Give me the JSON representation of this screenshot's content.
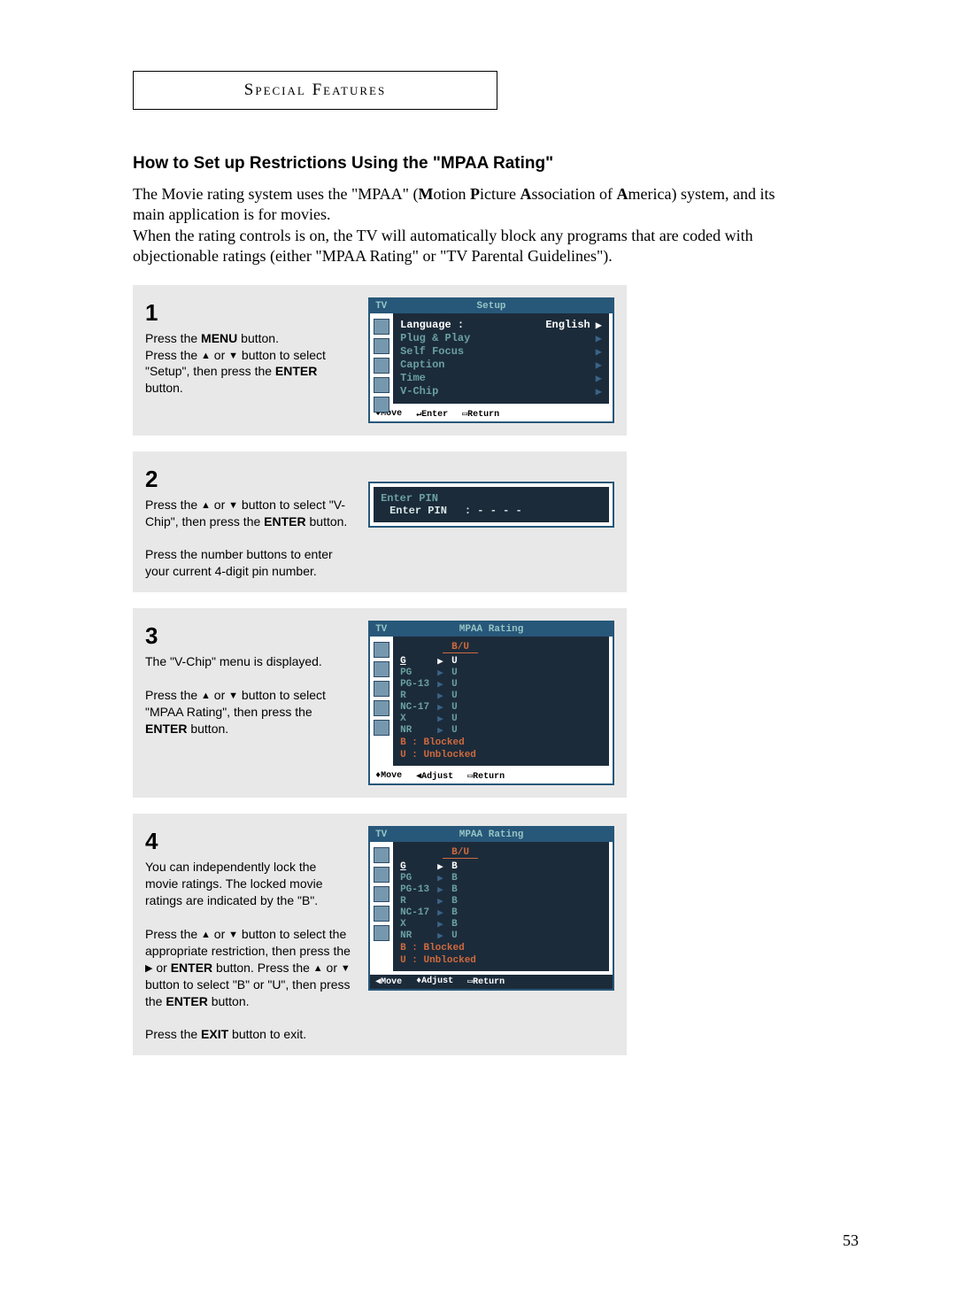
{
  "header": "Special Features",
  "title": "How to Set up Restrictions Using the \"MPAA Rating\"",
  "intro_html": "The Movie rating system uses the \"MPAA\" (<b>M</b>otion <b>P</b>icture <b>A</b>ssociation of <b>A</b>merica) system, and its main application is for movies.<br>When the rating controls is on, the TV will automatically block any programs that are coded with objectionable ratings (either \"MPAA Rating\" or \"TV Parental Guidelines\").",
  "steps": {
    "s1": {
      "num": "1",
      "text_html": "Press the <b>MENU</b> button.<br>Press the <span class='arrow-glyph'>▲</span> or <span class='arrow-glyph'>▼</span> button to select \"Setup\", then press the <b>ENTER</b> button."
    },
    "s2": {
      "num": "2",
      "text_html": "Press the <span class='arrow-glyph'>▲</span> or <span class='arrow-glyph'>▼</span> button to select \"V-Chip\", then press the <b>ENTER</b> button.<br><br>Press the number buttons to enter your current 4-digit pin number."
    },
    "s3": {
      "num": "3",
      "text_html": "The \"V-Chip\" menu is displayed.<br><br>Press the <span class='arrow-glyph'>▲</span> or <span class='arrow-glyph'>▼</span> button to select \"MPAA Rating\", then press the <b>ENTER</b> button."
    },
    "s4": {
      "num": "4",
      "text_html": "You can independently lock the movie ratings. The locked movie ratings are indicated by the \"B\".<br><br>Press the <span class='arrow-glyph'>▲</span> or <span class='arrow-glyph'>▼</span> button to select the appropriate restriction, then press  the <span class='arrow-glyph'>▶</span> or <b>ENTER</b> button. Press the <span class='arrow-glyph'>▲</span> or <span class='arrow-glyph'>▼</span> button to select \"B\" or \"U\", then press the <b>ENTER</b> button.<br><br>Press the <b>EXIT</b> button to exit."
    }
  },
  "osd1": {
    "tv": "TV",
    "title": "Setup",
    "items": [
      {
        "label": "Language  :",
        "value": "English",
        "sel": true
      },
      {
        "label": "Plug & Play",
        "value": "",
        "sel": false
      },
      {
        "label": "Self Focus",
        "value": "",
        "sel": false
      },
      {
        "label": "Caption",
        "value": "",
        "sel": false
      },
      {
        "label": "Time",
        "value": "",
        "sel": false
      },
      {
        "label": "V-Chip",
        "value": "",
        "sel": false
      }
    ],
    "help": {
      "move": "♦Move",
      "enter": "↵Enter",
      "ret": "▭Return"
    }
  },
  "osd2": {
    "title": "Enter PIN",
    "line": "Enter PIN",
    "val": ": - - - -"
  },
  "osd3": {
    "tv": "TV",
    "title": "MPAA Rating",
    "bu": "B/U",
    "rows": [
      {
        "label": "G",
        "val": "U",
        "sel": true
      },
      {
        "label": "PG",
        "val": "U",
        "sel": false
      },
      {
        "label": "PG-13",
        "val": "U",
        "sel": false
      },
      {
        "label": "R",
        "val": "U",
        "sel": false
      },
      {
        "label": "NC-17",
        "val": "U",
        "sel": false
      },
      {
        "label": "X",
        "val": "U",
        "sel": false
      },
      {
        "label": "NR",
        "val": "U",
        "sel": false
      }
    ],
    "legend1": "B : Blocked",
    "legend2": "U : Unblocked",
    "help": {
      "move": "♦Move",
      "adjust": "◀Adjust",
      "ret": "▭Return"
    }
  },
  "osd4": {
    "tv": "TV",
    "title": "MPAA Rating",
    "bu": "B/U",
    "rows": [
      {
        "label": "G",
        "val": "B",
        "sel": true
      },
      {
        "label": "PG",
        "val": "B",
        "sel": false
      },
      {
        "label": "PG-13",
        "val": "B",
        "sel": false
      },
      {
        "label": "R",
        "val": "B",
        "sel": false
      },
      {
        "label": "NC-17",
        "val": "B",
        "sel": false
      },
      {
        "label": "X",
        "val": "B",
        "sel": false
      },
      {
        "label": "NR",
        "val": "U",
        "sel": false
      }
    ],
    "legend1": "B : Blocked",
    "legend2": "U : Unblocked",
    "help": {
      "move": "◀Move",
      "adjust": "♦Adjust",
      "ret": "▭Return"
    }
  },
  "page_num": "53"
}
